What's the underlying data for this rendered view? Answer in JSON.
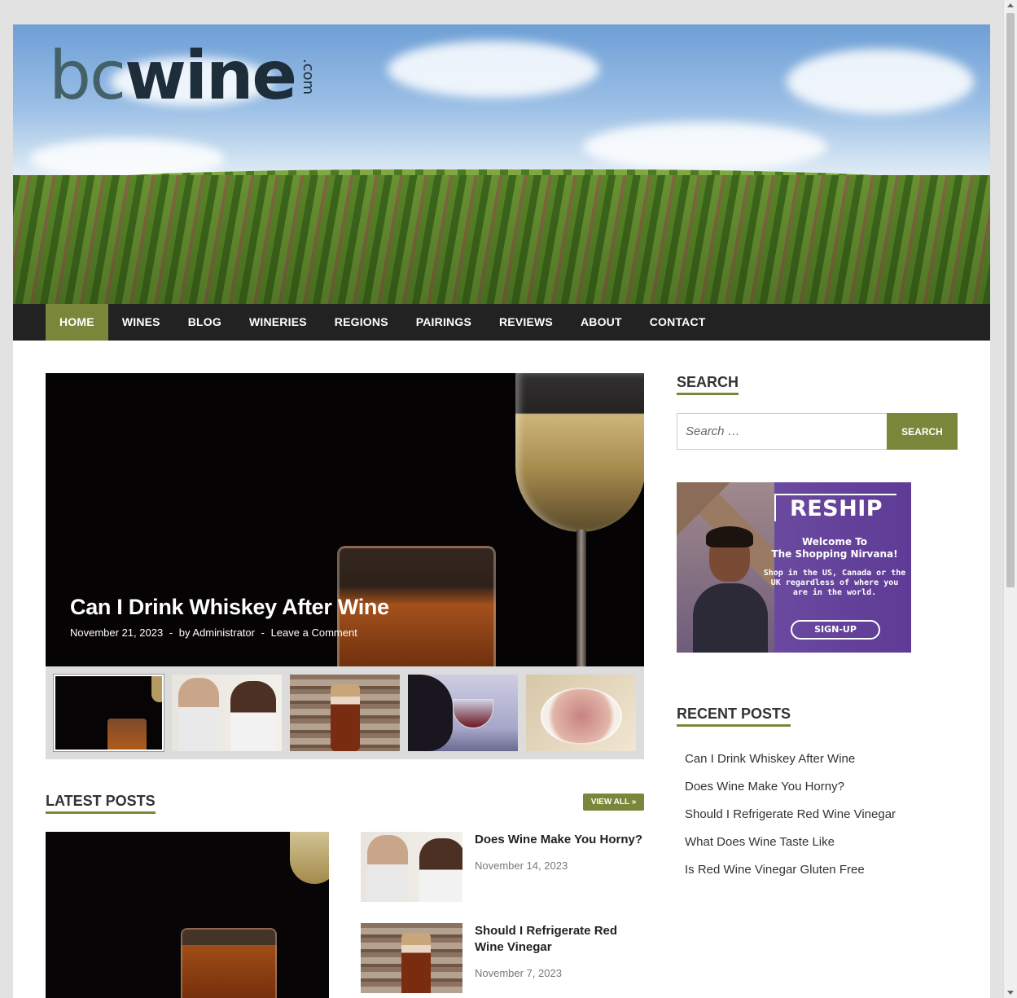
{
  "brand": {
    "logo_main_1": "bc",
    "logo_main_2": "wine",
    "logo_suffix": ".com"
  },
  "nav": {
    "items": [
      {
        "label": "HOME",
        "active": true
      },
      {
        "label": "WINES"
      },
      {
        "label": "BLOG"
      },
      {
        "label": "WINERIES"
      },
      {
        "label": "REGIONS"
      },
      {
        "label": "PAIRINGS"
      },
      {
        "label": "REVIEWS"
      },
      {
        "label": "ABOUT"
      },
      {
        "label": "CONTACT"
      }
    ]
  },
  "slider": {
    "title": "Can I Drink Whiskey After Wine",
    "date": "November 21, 2023",
    "sep1": "-",
    "author": "by Administrator",
    "sep2": "-",
    "comments": "Leave a Comment"
  },
  "latest": {
    "heading": "LATEST POSTS",
    "view_all": "VIEW ALL »",
    "posts": [
      {
        "title": "Does Wine Make You Horny?",
        "date": "November 14, 2023"
      },
      {
        "title": "Should I Refrigerate Red Wine Vinegar",
        "date": "November 7, 2023"
      }
    ]
  },
  "sidebar": {
    "search_heading": "SEARCH",
    "search_placeholder": "Search …",
    "search_button": "SEARCH",
    "ad": {
      "brand": "RESHIP",
      "welcome_line1": "Welcome To",
      "welcome_line2": "The Shopping Nirvana!",
      "body": "Shop in the US, Canada or the UK regardless of where you are in the world.",
      "button": "SIGN-UP"
    },
    "recent_heading": "RECENT POSTS",
    "recent": [
      "Can I Drink Whiskey After Wine",
      "Does Wine Make You Horny?",
      "Should I Refrigerate Red Wine Vinegar",
      "What Does Wine Taste Like",
      "Is Red Wine Vinegar Gluten Free"
    ]
  },
  "colors": {
    "accent": "#7a873b",
    "nav_bg": "#222222"
  }
}
